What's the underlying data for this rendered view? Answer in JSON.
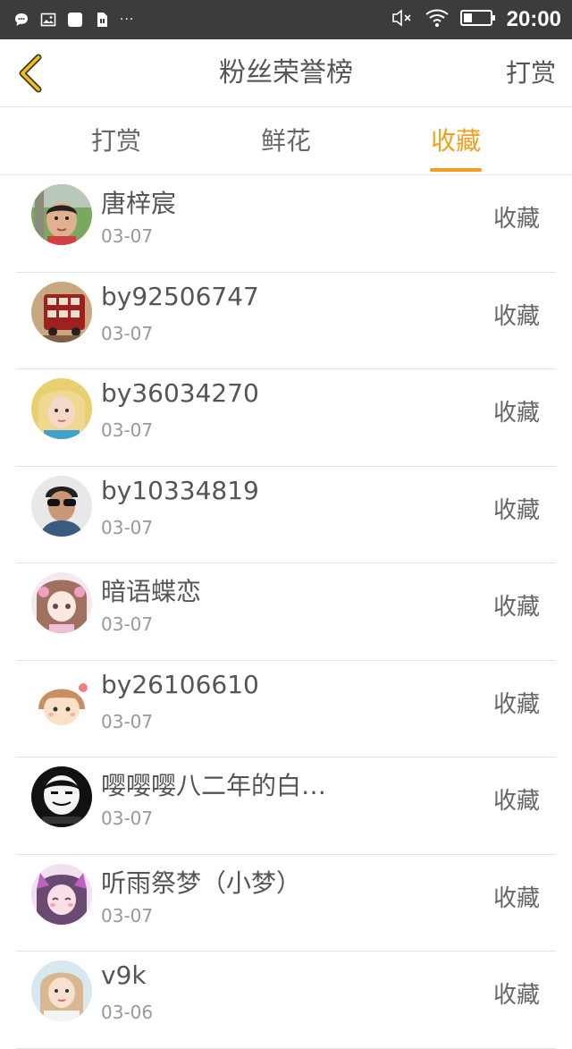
{
  "status_bar": {
    "time": "20:00",
    "dots": "···"
  },
  "header": {
    "title": "粉丝荣誉榜",
    "right_action": "打赏"
  },
  "tabs": [
    {
      "label": "打赏",
      "active": false
    },
    {
      "label": "鲜花",
      "active": false
    },
    {
      "label": "收藏",
      "active": true
    }
  ],
  "colors": {
    "accent": "#f0a020",
    "status_bar_bg": "#3c3c3c",
    "text": "#555555",
    "subtext": "#999999"
  },
  "fans": [
    {
      "name": "唐梓宸",
      "date": "03-07",
      "action": "收藏",
      "avatar": "boy-photo-avatar"
    },
    {
      "name": "by92506747",
      "date": "03-07",
      "action": "收藏",
      "avatar": "red-bus-avatar"
    },
    {
      "name": "by36034270",
      "date": "03-07",
      "action": "收藏",
      "avatar": "blonde-girl-avatar"
    },
    {
      "name": "by10334819",
      "date": "03-07",
      "action": "收藏",
      "avatar": "man-sunglasses-avatar"
    },
    {
      "name": "暗语蝶恋",
      "date": "03-07",
      "action": "收藏",
      "avatar": "anime-girl-avatar"
    },
    {
      "name": "by26106610",
      "date": "03-07",
      "action": "收藏",
      "avatar": "cartoon-girl-avatar"
    },
    {
      "name": "嘤嘤嘤八二年的白…",
      "date": "03-07",
      "action": "收藏",
      "avatar": "meme-face-avatar"
    },
    {
      "name": "听雨祭梦（小梦）",
      "date": "03-07",
      "action": "收藏",
      "avatar": "cat-ear-girl-avatar"
    },
    {
      "name": "v9k",
      "date": "03-06",
      "action": "收藏",
      "avatar": "girl-photo-avatar"
    }
  ]
}
